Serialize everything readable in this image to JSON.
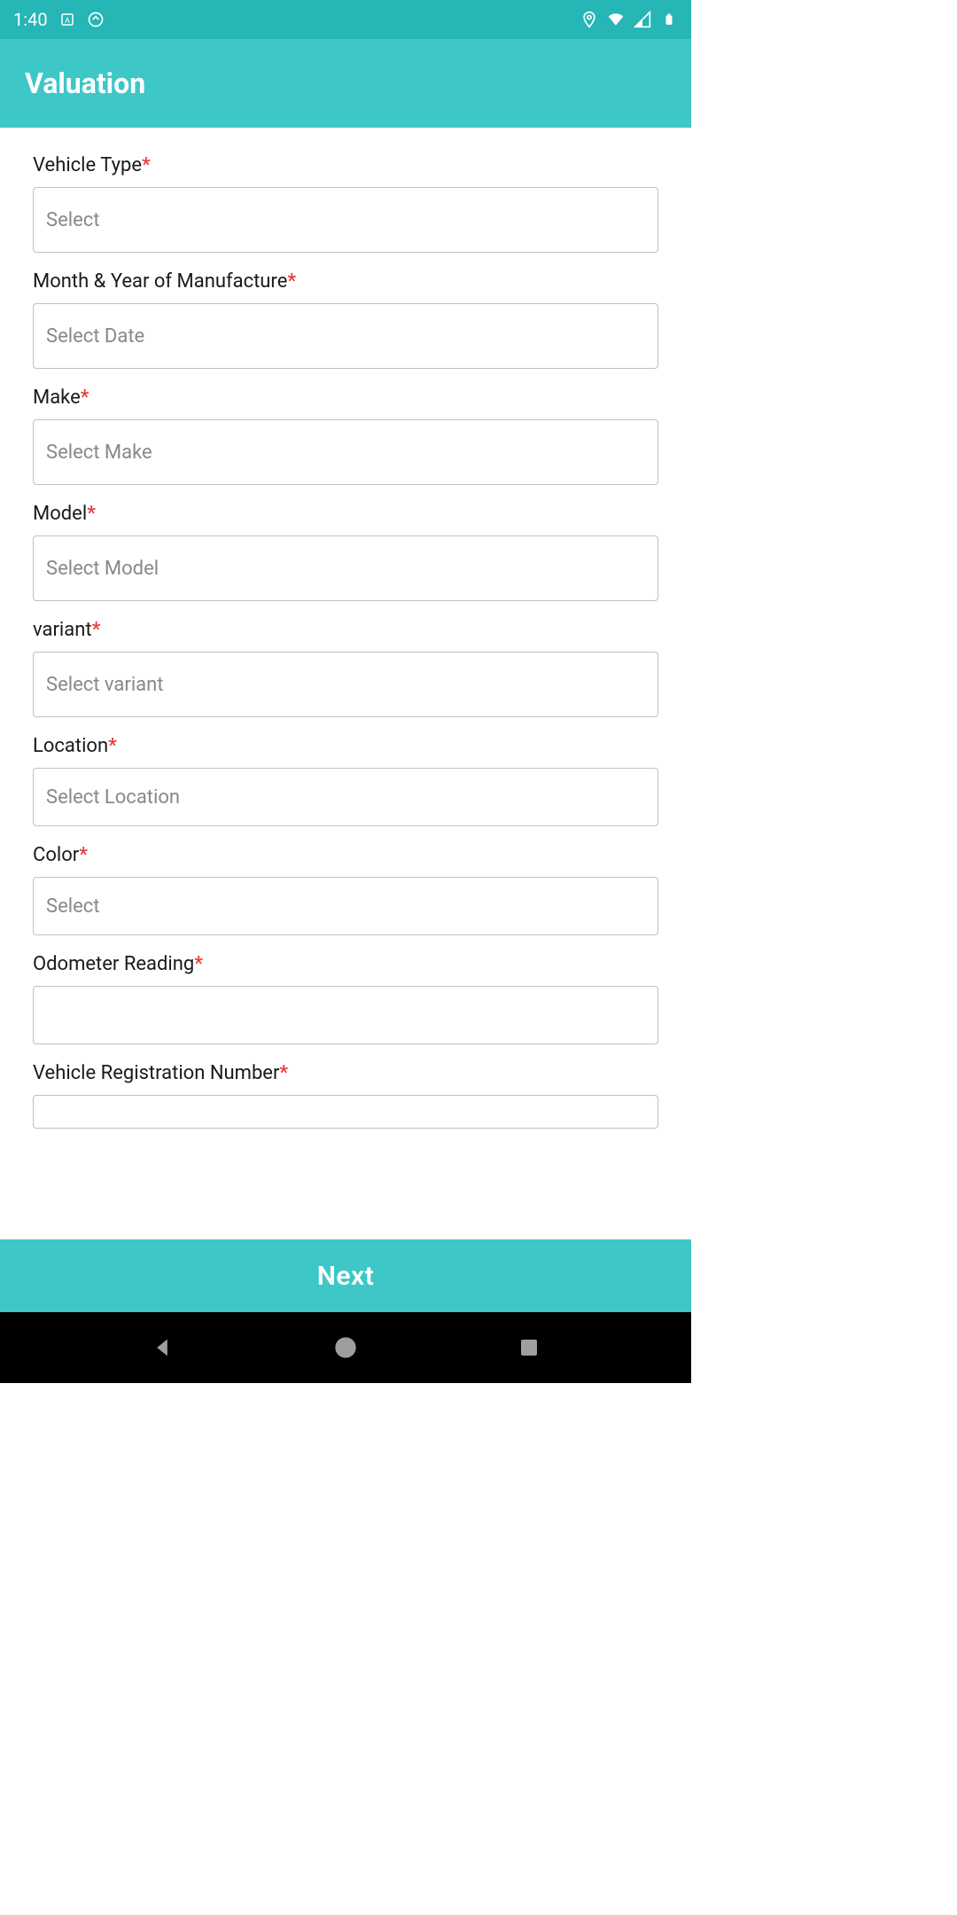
{
  "statusBar": {
    "time": "1:40"
  },
  "header": {
    "title": "Valuation"
  },
  "form": {
    "vehicleType": {
      "label": "Vehicle Type",
      "placeholder": "Select"
    },
    "manufactureDate": {
      "label": "Month & Year of Manufacture",
      "placeholder": "Select Date"
    },
    "make": {
      "label": "Make",
      "placeholder": "Select Make"
    },
    "model": {
      "label": "Model",
      "placeholder": "Select Model"
    },
    "variant": {
      "label": "variant",
      "placeholder": "Select variant"
    },
    "location": {
      "label": "Location",
      "placeholder": "Select Location"
    },
    "color": {
      "label": "Color",
      "placeholder": "Select"
    },
    "odometer": {
      "label": "Odometer Reading",
      "placeholder": ""
    },
    "registration": {
      "label": "Vehicle Registration Number",
      "placeholder": ""
    }
  },
  "footer": {
    "nextButton": "Next"
  }
}
